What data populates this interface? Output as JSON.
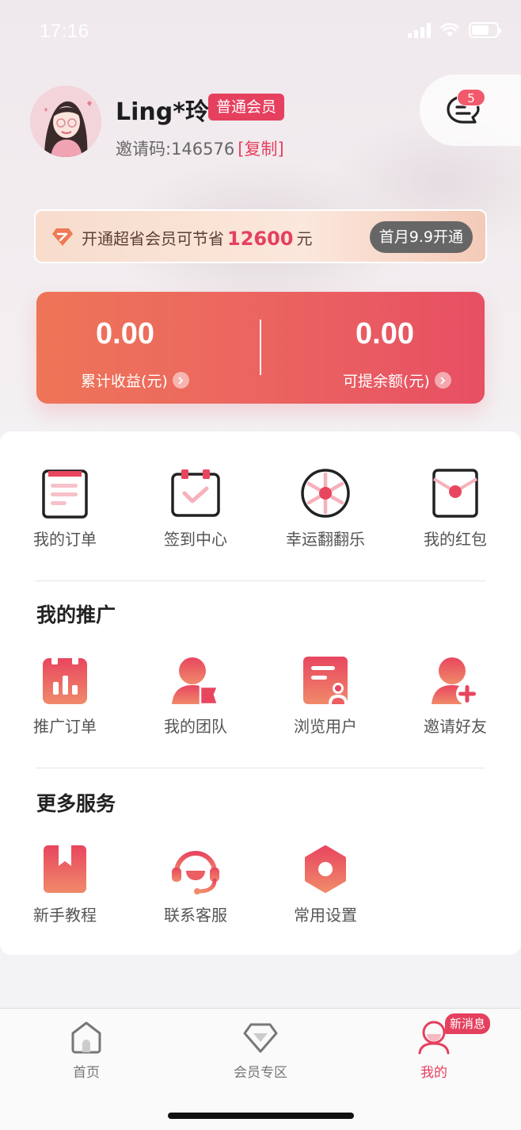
{
  "status_bar": {
    "time": "17:16"
  },
  "profile": {
    "username": "Ling*玲",
    "member_level": "普通会员",
    "invite_label": "邀请码:146576",
    "copy_label": "[复制]"
  },
  "messages": {
    "badge_count": "5"
  },
  "vip_banner": {
    "text_before": "开通超省会员可节省",
    "amount": "12600",
    "unit": "元",
    "button_label": "首月9.9开通"
  },
  "earnings": {
    "total": {
      "value": "0.00",
      "label": "累计收益(元)"
    },
    "withdrawable": {
      "value": "0.00",
      "label": "可提余额(元)"
    }
  },
  "quick_actions": [
    {
      "label": "我的订单",
      "icon": "order-icon"
    },
    {
      "label": "签到中心",
      "icon": "calendar-check-icon"
    },
    {
      "label": "幸运翻翻乐",
      "icon": "lucky-wheel-icon"
    },
    {
      "label": "我的红包",
      "icon": "red-envelope-icon"
    }
  ],
  "promotion": {
    "title": "我的推广",
    "items": [
      {
        "label": "推广订单",
        "icon": "promo-order-icon"
      },
      {
        "label": "我的团队",
        "icon": "team-icon"
      },
      {
        "label": "浏览用户",
        "icon": "browse-user-icon"
      },
      {
        "label": "邀请好友",
        "icon": "invite-friend-icon"
      }
    ]
  },
  "services": {
    "title": "更多服务",
    "items": [
      {
        "label": "新手教程",
        "icon": "tutorial-book-icon"
      },
      {
        "label": "联系客服",
        "icon": "headset-icon"
      },
      {
        "label": "常用设置",
        "icon": "settings-icon"
      }
    ]
  },
  "tab_bar": {
    "tabs": [
      {
        "label": "首页",
        "icon": "home-icon"
      },
      {
        "label": "会员专区",
        "icon": "diamond-icon"
      },
      {
        "label": "我的",
        "icon": "profile-icon",
        "active": true
      }
    ],
    "new_message_badge": "新消息"
  },
  "colors": {
    "accent": "#e5405e",
    "card_gradient_start": "#ee7558",
    "card_gradient_end": "#e74f63"
  }
}
